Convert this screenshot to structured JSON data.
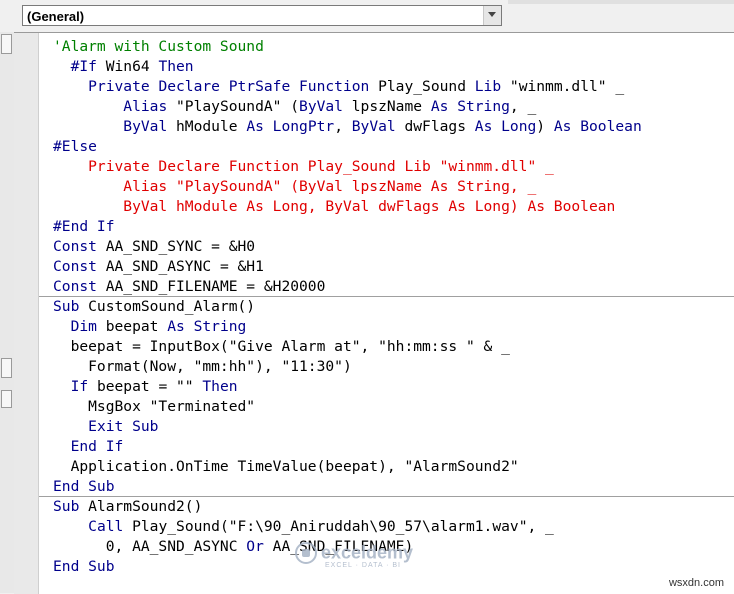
{
  "object_combo": {
    "value": "(General)"
  },
  "code": {
    "block1": [
      [
        {
          "t": "'Alarm with Custom Sound",
          "c": "cm"
        }
      ],
      [
        {
          "t": "  "
        },
        {
          "t": "#If",
          "c": "kw"
        },
        {
          "t": " Win64 "
        },
        {
          "t": "Then",
          "c": "kw"
        }
      ],
      [
        {
          "t": "    "
        },
        {
          "t": "Private Declare PtrSafe Function",
          "c": "kw"
        },
        {
          "t": " Play_Sound "
        },
        {
          "t": "Lib",
          "c": "kw"
        },
        {
          "t": " \"winmm.dll\" _"
        }
      ],
      [
        {
          "t": "        "
        },
        {
          "t": "Alias",
          "c": "kw"
        },
        {
          "t": " \"PlaySoundA\" ("
        },
        {
          "t": "ByVal",
          "c": "kw"
        },
        {
          "t": " lpszName "
        },
        {
          "t": "As String",
          "c": "kw"
        },
        {
          "t": ", _"
        }
      ],
      [
        {
          "t": "        "
        },
        {
          "t": "ByVal",
          "c": "kw"
        },
        {
          "t": " hModule "
        },
        {
          "t": "As LongPtr",
          "c": "kw"
        },
        {
          "t": ", "
        },
        {
          "t": "ByVal",
          "c": "kw"
        },
        {
          "t": " dwFlags "
        },
        {
          "t": "As Long",
          "c": "kw"
        },
        {
          "t": ") "
        },
        {
          "t": "As Boolean",
          "c": "kw"
        }
      ],
      [
        {
          "t": "#Else",
          "c": "kw"
        }
      ],
      [
        {
          "t": "    Private Declare Function Play_Sound Lib \"winmm.dll\" _",
          "c": "err"
        }
      ],
      [
        {
          "t": "        Alias \"PlaySoundA\" (ByVal lpszName As String, _",
          "c": "err"
        }
      ],
      [
        {
          "t": "        ByVal hModule As Long, ByVal dwFlags As Long) As Boolean",
          "c": "err"
        }
      ],
      [
        {
          "t": "#End If",
          "c": "kw"
        }
      ],
      [
        {
          "t": "Const",
          "c": "kw"
        },
        {
          "t": " AA_SND_SYNC = &H0"
        }
      ],
      [
        {
          "t": "Const",
          "c": "kw"
        },
        {
          "t": " AA_SND_ASYNC = &H1"
        }
      ],
      [
        {
          "t": "Const",
          "c": "kw"
        },
        {
          "t": " AA_SND_FILENAME = &H20000"
        }
      ]
    ],
    "block2": [
      [
        {
          "t": "Sub",
          "c": "kw"
        },
        {
          "t": " CustomSound_Alarm()"
        }
      ],
      [
        {
          "t": "  "
        },
        {
          "t": "Dim",
          "c": "kw"
        },
        {
          "t": " beepat "
        },
        {
          "t": "As String",
          "c": "kw"
        }
      ],
      [
        {
          "t": "  beepat = InputBox(\"Give Alarm at\", \"hh:mm:ss \" & _"
        }
      ],
      [
        {
          "t": "    Format(Now, \"mm:hh\"), \"11:30\")"
        }
      ],
      [
        {
          "t": "  "
        },
        {
          "t": "If",
          "c": "kw"
        },
        {
          "t": " beepat = \"\" "
        },
        {
          "t": "Then",
          "c": "kw"
        }
      ],
      [
        {
          "t": "    MsgBox \"Terminated\""
        }
      ],
      [
        {
          "t": "    "
        },
        {
          "t": "Exit Sub",
          "c": "kw"
        }
      ],
      [
        {
          "t": "  "
        },
        {
          "t": "End If",
          "c": "kw"
        }
      ],
      [
        {
          "t": "  Application.OnTime TimeValue(beepat), \"AlarmSound2\""
        }
      ],
      [
        {
          "t": "End Sub",
          "c": "kw"
        }
      ]
    ],
    "block3": [
      [
        {
          "t": "Sub",
          "c": "kw"
        },
        {
          "t": " AlarmSound2()"
        }
      ],
      [
        {
          "t": "    "
        },
        {
          "t": "Call",
          "c": "kw"
        },
        {
          "t": " Play_Sound(\"F:\\90_Aniruddah\\90_57\\alarm1.wav\", _"
        }
      ],
      [
        {
          "t": "      0, AA_SND_ASYNC "
        },
        {
          "t": "Or",
          "c": "kw"
        },
        {
          "t": " AA_SND_FILENAME)"
        }
      ],
      [
        {
          "t": "End Sub",
          "c": "kw"
        }
      ]
    ]
  },
  "watermark": {
    "name": "exceldemy",
    "tagline": "EXCEL · DATA · BI"
  },
  "site_credit": "wsxdn.com",
  "colors": {
    "keyword": "#00008b",
    "comment": "#008000",
    "error": "#e00000",
    "text": "#000000"
  },
  "icons": {
    "combo_dropdown": "chevron-down-icon",
    "watermark_logo": "exceldemy-logo-icon"
  }
}
